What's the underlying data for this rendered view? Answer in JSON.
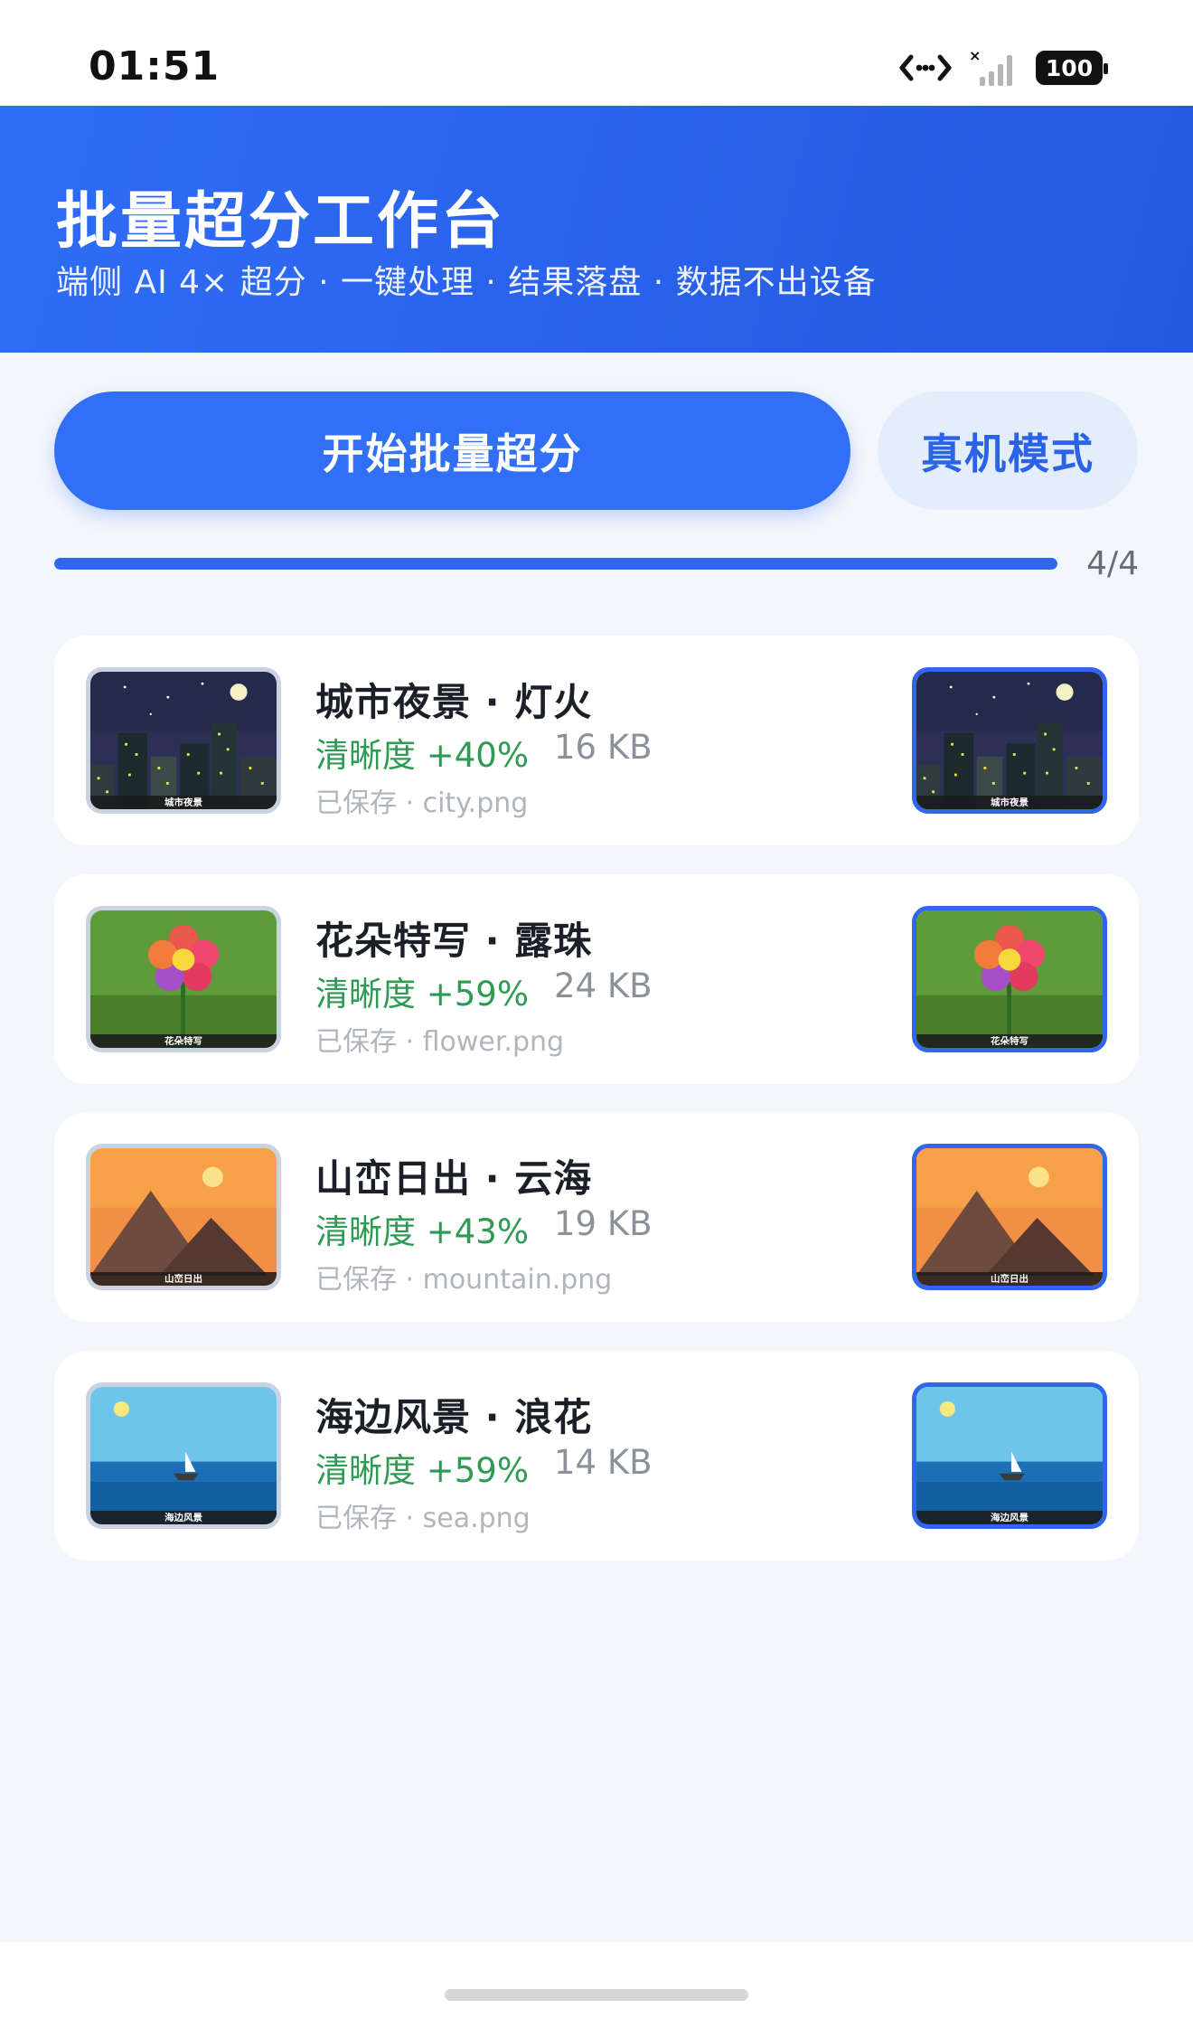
{
  "status": {
    "time": "01:51",
    "battery": "100"
  },
  "header": {
    "title": "批量超分工作台",
    "subtitle": "端侧 AI 4× 超分 · 一键处理 · 结果落盘 · 数据不出设备"
  },
  "actions": {
    "start_label": "开始批量超分",
    "mode_label": "真机模式"
  },
  "progress": {
    "text": "4/4",
    "fraction": 1.0
  },
  "items": [
    {
      "title": "城市夜景 · 灯火",
      "metric": "清晰度 +40%",
      "size": "16 KB",
      "saved": "已保存 · city.png",
      "thumb_label": "城市夜景",
      "scene": "city"
    },
    {
      "title": "花朵特写 · 露珠",
      "metric": "清晰度 +59%",
      "size": "24 KB",
      "saved": "已保存 · flower.png",
      "thumb_label": "花朵特写",
      "scene": "flower"
    },
    {
      "title": "山峦日出 · 云海",
      "metric": "清晰度 +43%",
      "size": "19 KB",
      "saved": "已保存 · mountain.png",
      "thumb_label": "山峦日出",
      "scene": "mountain"
    },
    {
      "title": "海边风景 · 浪花",
      "metric": "清晰度 +59%",
      "size": "14 KB",
      "saved": "已保存 · sea.png",
      "thumb_label": "海边风景",
      "scene": "sea"
    }
  ],
  "colors": {
    "accent": "#2f66ea",
    "header": "#2a62ee",
    "metric": "#2e9a53"
  }
}
